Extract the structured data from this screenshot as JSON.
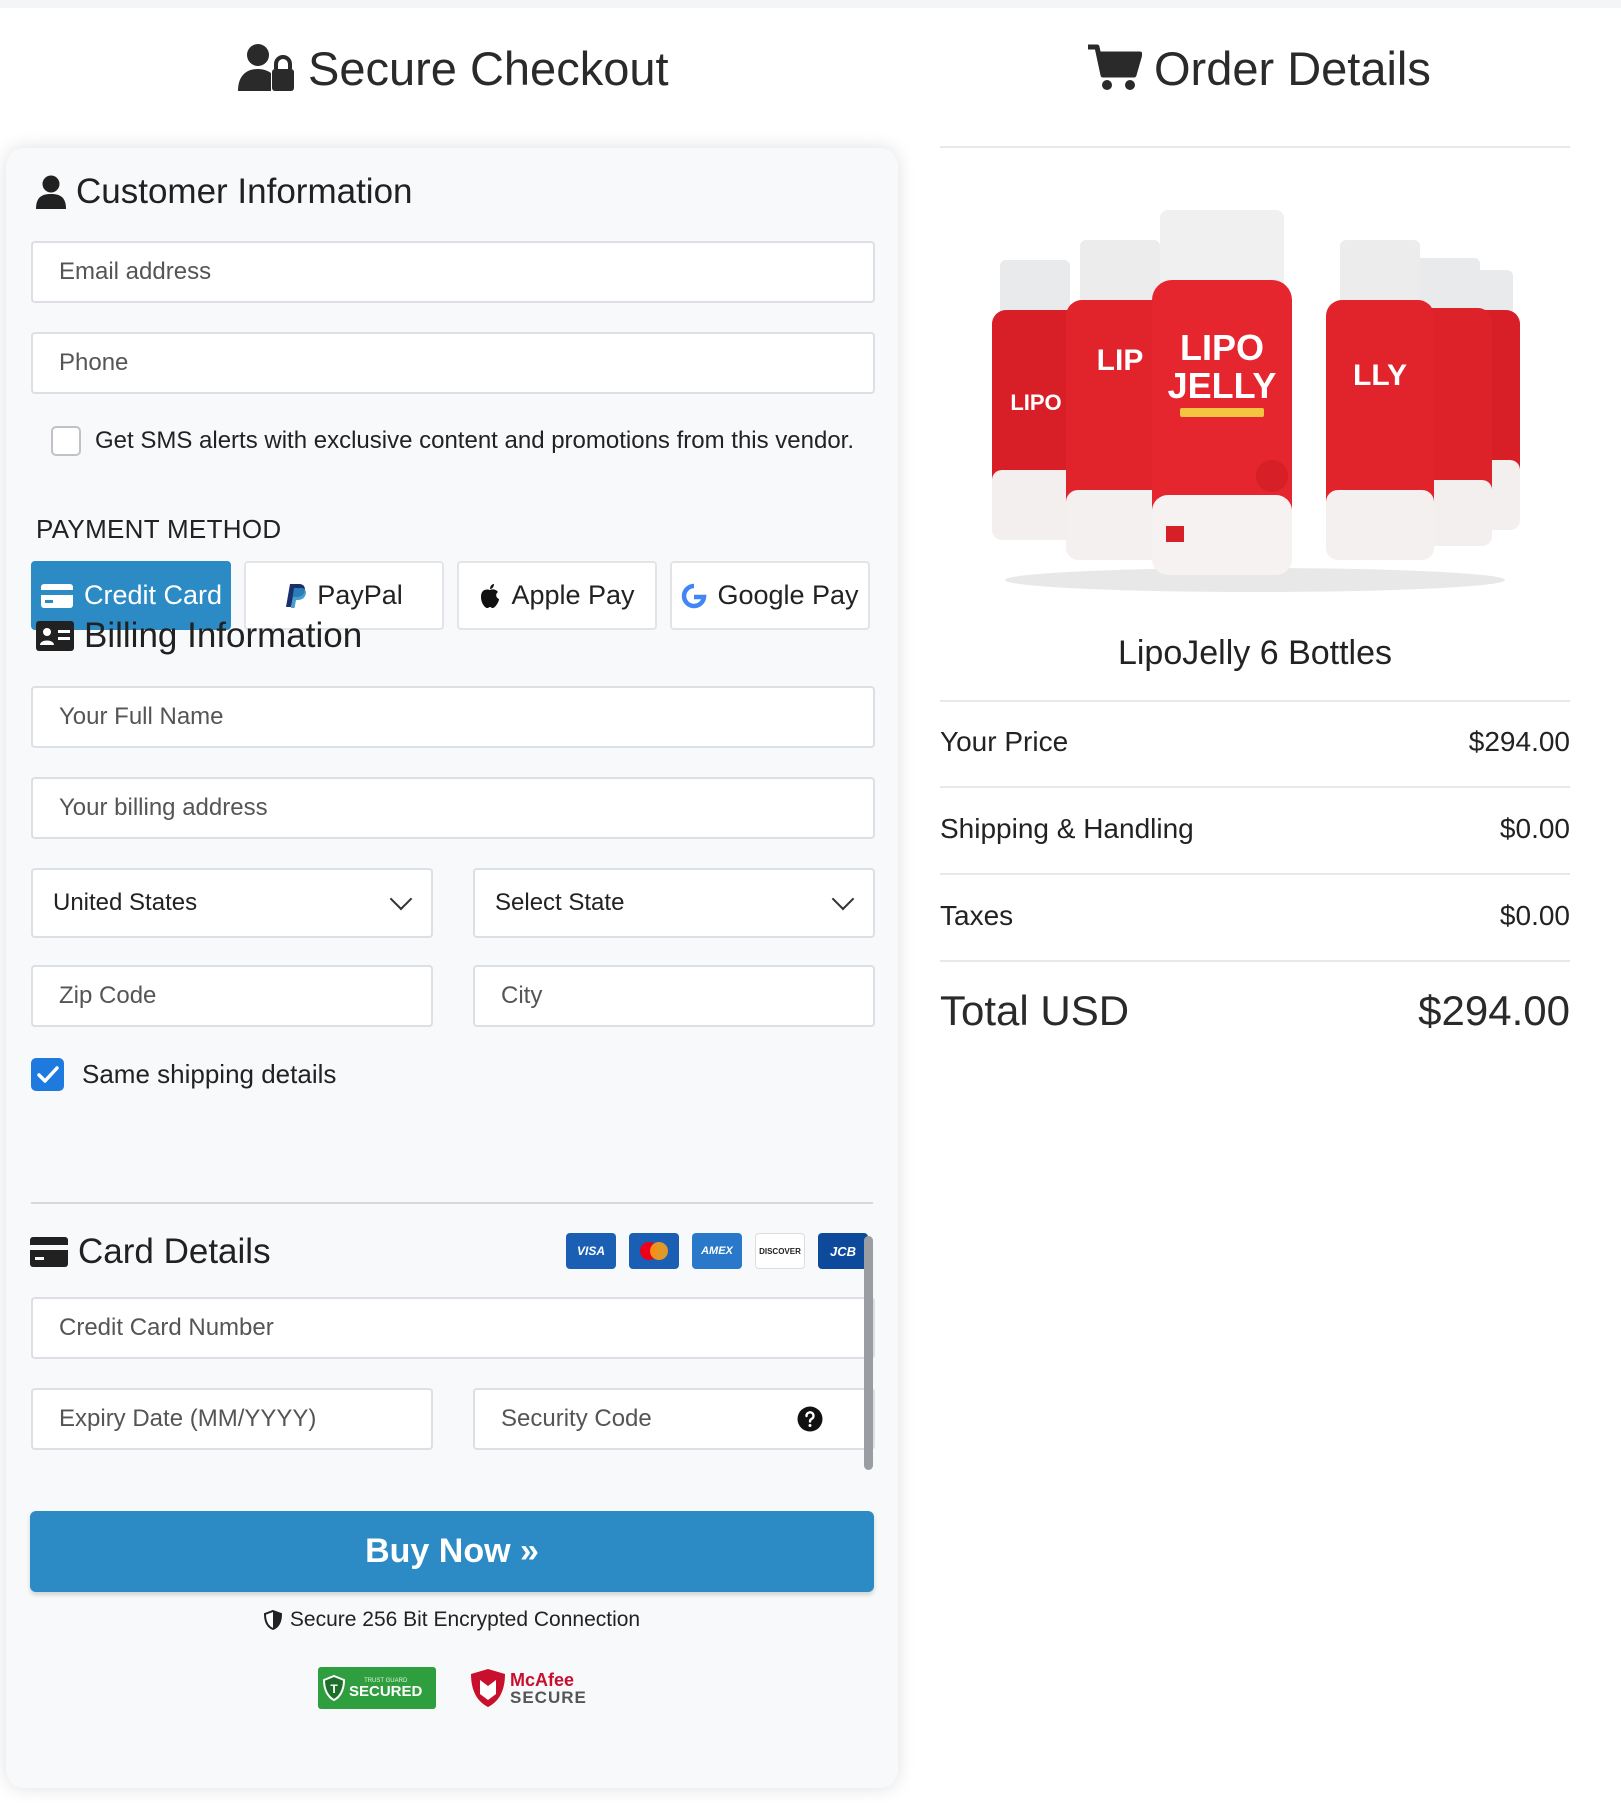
{
  "checkout": {
    "title": "Secure Checkout",
    "customer_section": {
      "title": "Customer Information",
      "email_placeholder": "Email address",
      "phone_placeholder": "Phone",
      "sms_label": "Get SMS alerts with exclusive content and promotions from this vendor.",
      "sms_checked": false
    },
    "payment_method": {
      "label": "PAYMENT METHOD",
      "options": [
        {
          "label": "Credit Card",
          "icon": "credit-card-icon",
          "active": true
        },
        {
          "label": "PayPal",
          "icon": "paypal-icon",
          "active": false
        },
        {
          "label": "Apple Pay",
          "icon": "apple-icon",
          "active": false
        },
        {
          "label": "Google Pay",
          "icon": "google-icon",
          "active": false
        }
      ]
    },
    "billing_section": {
      "title": "Billing Information",
      "full_name_placeholder": "Your Full Name",
      "address_placeholder": "Your billing address",
      "country_value": "United States",
      "state_value": "Select State",
      "zip_placeholder": "Zip Code",
      "city_placeholder": "City",
      "same_shipping_label": "Same shipping details",
      "same_shipping_checked": true
    },
    "card_section": {
      "title": "Card Details",
      "card_logos": [
        "VISA",
        "mastercard",
        "AMEX",
        "DISCOVER",
        "JCB"
      ],
      "card_number_placeholder": "Credit Card Number",
      "expiry_placeholder": "Expiry Date (MM/YYYY)",
      "security_placeholder": "Security Code"
    },
    "buy_button": "Buy Now »",
    "secure_text": "Secure 256 Bit Encrypted Connection",
    "badges": {
      "trust_top": "TRUST GUARD",
      "trust_main": "SECURED",
      "mcafee_top": "McAfee",
      "mcafee_bottom": "SECURE"
    }
  },
  "order": {
    "title": "Order Details",
    "product_name": "LipoJelly 6 Bottles",
    "product_label_line1": "LIPO",
    "product_label_line2": "JELLY",
    "rows": [
      {
        "label": "Your Price",
        "value": "$294.00"
      },
      {
        "label": "Shipping & Handling",
        "value": "$0.00"
      },
      {
        "label": "Taxes",
        "value": "$0.00"
      }
    ],
    "total_label": "Total USD",
    "total_value": "$294.00"
  },
  "colors": {
    "accent": "#2c8bc5",
    "checkbox": "#1f7ae0",
    "panel_bg": "#f8f9fa",
    "product_red": "#e5262e"
  }
}
